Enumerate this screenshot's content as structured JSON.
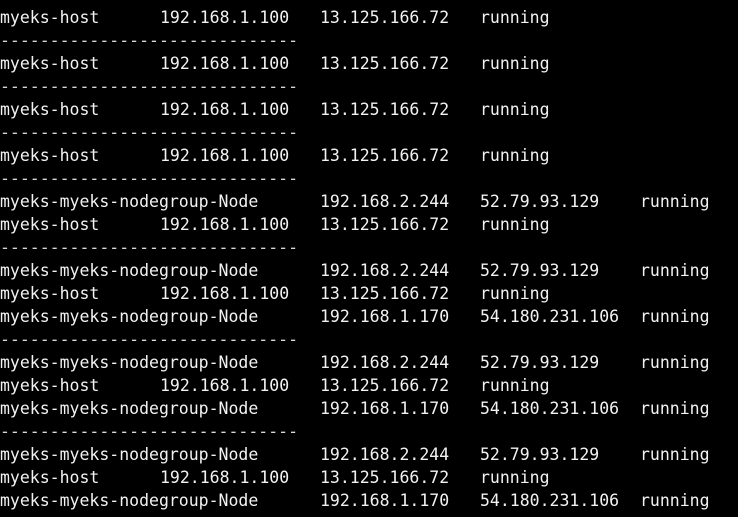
{
  "terminal": {
    "lines": [
      {
        "kind": "row",
        "name": "myeks-host",
        "private_ip": "192.168.1.100",
        "public_ip": "13.125.166.72",
        "state": "running"
      },
      {
        "kind": "separator",
        "text": "------------------------------"
      },
      {
        "kind": "row",
        "name": "myeks-host",
        "private_ip": "192.168.1.100",
        "public_ip": "13.125.166.72",
        "state": "running"
      },
      {
        "kind": "separator",
        "text": "------------------------------"
      },
      {
        "kind": "row",
        "name": "myeks-host",
        "private_ip": "192.168.1.100",
        "public_ip": "13.125.166.72",
        "state": "running"
      },
      {
        "kind": "separator",
        "text": "------------------------------"
      },
      {
        "kind": "row",
        "name": "myeks-host",
        "private_ip": "192.168.1.100",
        "public_ip": "13.125.166.72",
        "state": "running"
      },
      {
        "kind": "separator",
        "text": "------------------------------"
      },
      {
        "kind": "row",
        "name": "myeks-myeks-nodegroup-Node",
        "private_ip": "192.168.2.244",
        "public_ip": "52.79.93.129",
        "state": "running"
      },
      {
        "kind": "row",
        "name": "myeks-host",
        "private_ip": "192.168.1.100",
        "public_ip": "13.125.166.72",
        "state": "running"
      },
      {
        "kind": "separator",
        "text": "------------------------------"
      },
      {
        "kind": "row",
        "name": "myeks-myeks-nodegroup-Node",
        "private_ip": "192.168.2.244",
        "public_ip": "52.79.93.129",
        "state": "running"
      },
      {
        "kind": "row",
        "name": "myeks-host",
        "private_ip": "192.168.1.100",
        "public_ip": "13.125.166.72",
        "state": "running"
      },
      {
        "kind": "row",
        "name": "myeks-myeks-nodegroup-Node",
        "private_ip": "192.168.1.170",
        "public_ip": "54.180.231.106",
        "state": "running"
      },
      {
        "kind": "separator",
        "text": "------------------------------"
      },
      {
        "kind": "row",
        "name": "myeks-myeks-nodegroup-Node",
        "private_ip": "192.168.2.244",
        "public_ip": "52.79.93.129",
        "state": "running"
      },
      {
        "kind": "row",
        "name": "myeks-host",
        "private_ip": "192.168.1.100",
        "public_ip": "13.125.166.72",
        "state": "running"
      },
      {
        "kind": "row",
        "name": "myeks-myeks-nodegroup-Node",
        "private_ip": "192.168.1.170",
        "public_ip": "54.180.231.106",
        "state": "running"
      },
      {
        "kind": "separator",
        "text": "------------------------------"
      },
      {
        "kind": "row",
        "name": "myeks-myeks-nodegroup-Node",
        "private_ip": "192.168.2.244",
        "public_ip": "52.79.93.129",
        "state": "running"
      },
      {
        "kind": "row",
        "name": "myeks-host",
        "private_ip": "192.168.1.100",
        "public_ip": "13.125.166.72",
        "state": "running"
      },
      {
        "kind": "row",
        "name": "myeks-myeks-nodegroup-Node",
        "private_ip": "192.168.1.170",
        "public_ip": "54.180.231.106",
        "state": "running"
      }
    ]
  },
  "colors": {
    "background": "#000000",
    "text": "#f2f2f2"
  }
}
